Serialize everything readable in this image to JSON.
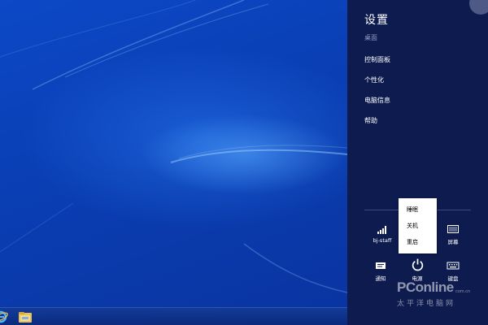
{
  "desktop": {
    "taskbar_icons": [
      "internet-explorer-icon",
      "file-explorer-folder-icon"
    ]
  },
  "settings_charm": {
    "title": "设置",
    "context": "桌面",
    "items": [
      {
        "label": "控制面板"
      },
      {
        "label": "个性化"
      },
      {
        "label": "电脑信息"
      },
      {
        "label": "帮助"
      }
    ],
    "quick_settings": {
      "network": {
        "label": "bj-staff",
        "icon": "wifi-signal-icon"
      },
      "volume": {
        "label": "",
        "icon": "speaker-icon"
      },
      "screen": {
        "label": "屏幕",
        "icon": "screen-brightness-icon"
      },
      "notifications": {
        "label": "通知",
        "icon": "notification-icon"
      },
      "power": {
        "label": "电源",
        "icon": "power-icon"
      },
      "keyboard": {
        "label": "键盘",
        "icon": "keyboard-icon"
      }
    },
    "power_menu": {
      "options": [
        {
          "label": "睡眠"
        },
        {
          "label": "关机"
        },
        {
          "label": "重启"
        }
      ]
    }
  },
  "watermark": {
    "logo": "PConline",
    "domain": "com.cn",
    "text": "太平洋电脑网"
  },
  "colors": {
    "charm_background": "#0d1b4f",
    "desktop_blue": "#0a3fb8",
    "menu_background": "#ffffff"
  }
}
